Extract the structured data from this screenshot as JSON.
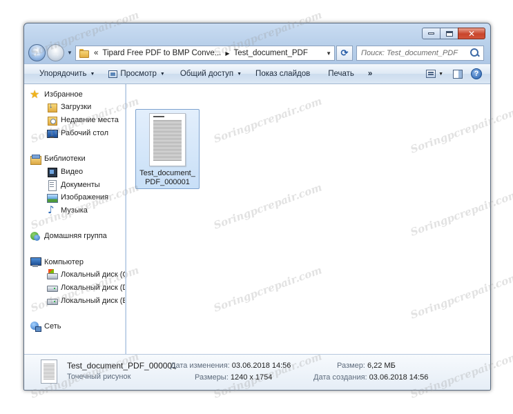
{
  "window": {
    "caption_buttons": {
      "minimize": "minimize",
      "maximize": "maximize",
      "close": "✕"
    }
  },
  "navigation": {
    "back": "←",
    "forward": "→",
    "address": {
      "overflow": "«",
      "segments": [
        "Tipard Free PDF to BMP Conve...",
        "Test_document_PDF"
      ]
    },
    "search_placeholder": "Поиск: Test_document_PDF"
  },
  "toolbar": {
    "organize": "Упорядочить",
    "view": "Просмотр",
    "share": "Общий доступ",
    "slideshow": "Показ слайдов",
    "print": "Печать",
    "more": "»"
  },
  "sidebar": {
    "favorites": {
      "label": "Избранное",
      "items": [
        "Загрузки",
        "Недавние места",
        "Рабочий стол"
      ]
    },
    "libraries": {
      "label": "Библиотеки",
      "items": [
        "Видео",
        "Документы",
        "Изображения",
        "Музыка"
      ]
    },
    "homegroup": "Домашняя группа",
    "computer": {
      "label": "Компьютер",
      "items": [
        "Локальный диск (C",
        "Локальный диск (D",
        "Локальный диск (E:"
      ]
    },
    "network": "Сеть"
  },
  "files": [
    {
      "name_line1": "Test_document_",
      "name_line2": "PDF_000001"
    }
  ],
  "details": {
    "file_name": "Test_document_PDF_000001",
    "file_type": "Точечный рисунок",
    "modified_label": "Дата изменения:",
    "modified_value": "03.06.2018 14:56",
    "dimensions_label": "Размеры:",
    "dimensions_value": "1240 x 1754",
    "size_label": "Размер:",
    "size_value": "6,22 МБ",
    "created_label": "Дата создания:",
    "created_value": "03.06.2018 14:56"
  },
  "watermark": "Soringpcrepair.com"
}
